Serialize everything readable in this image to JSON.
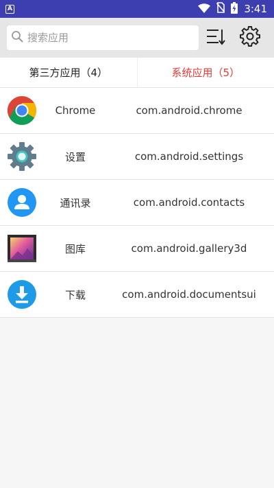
{
  "status_bar": {
    "time": "3:41",
    "app_indicator": "A",
    "icons": [
      "wifi-icon",
      "no-sim-icon",
      "battery-charging-icon"
    ]
  },
  "toolbar": {
    "search_placeholder": "搜索应用",
    "search_value": "",
    "sort_icon": "sort-icon",
    "settings_icon": "gear-icon"
  },
  "tabs": [
    {
      "label": "第三方应用（4）",
      "active": false
    },
    {
      "label": "系统应用（5）",
      "active": true
    }
  ],
  "apps": [
    {
      "name": "Chrome",
      "package": "com.android.chrome",
      "icon": "chrome-icon"
    },
    {
      "name": "设置",
      "package": "com.android.settings",
      "icon": "settings-app-icon"
    },
    {
      "name": "通讯录",
      "package": "com.android.contacts",
      "icon": "contacts-icon"
    },
    {
      "name": "图库",
      "package": "com.android.gallery3d",
      "icon": "gallery-icon"
    },
    {
      "name": "下载",
      "package": "com.android.documentsui",
      "icon": "download-icon"
    }
  ],
  "colors": {
    "status_bar": "#3d3fb0",
    "toolbar": "#e6e6e6",
    "active_tab": "#e53935",
    "background": "#f6f6f6"
  }
}
